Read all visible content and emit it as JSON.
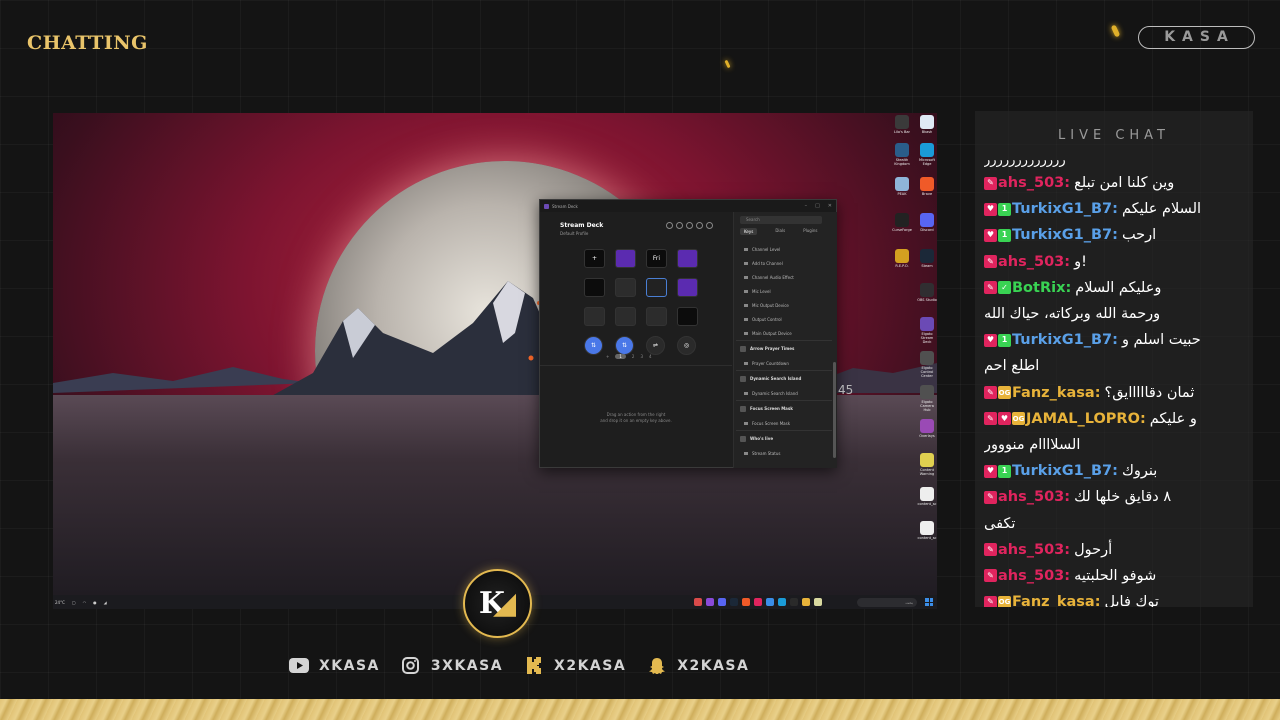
{
  "scene": {
    "title": "CHATTING",
    "brand": "KASA"
  },
  "screen": {
    "app": {
      "window_title": "Stream Deck",
      "device_name": "Stream Deck",
      "profile_name": "Default Profile",
      "keys": [
        {
          "label": "+",
          "style": "black"
        },
        {
          "label": "",
          "style": "purple"
        },
        {
          "label": "Fri",
          "style": "black"
        },
        {
          "label": "",
          "style": "purple"
        },
        {
          "label": "",
          "style": "black"
        },
        {
          "label": "",
          "style": "dark"
        },
        {
          "label": "",
          "style": "outline"
        },
        {
          "label": "",
          "style": "purple"
        },
        {
          "label": "",
          "style": "dark"
        },
        {
          "label": "",
          "style": "dark"
        },
        {
          "label": "",
          "style": "dark"
        },
        {
          "label": "",
          "style": "black"
        },
        {
          "label": "⇅",
          "style": "blue"
        },
        {
          "label": "⇅",
          "style": "blue"
        },
        {
          "label": "⇌",
          "style": "dark-round"
        },
        {
          "label": "◎",
          "style": "dark-round"
        }
      ],
      "pages": [
        "1",
        "2",
        "3",
        "4"
      ],
      "drop_hint_1": "Drag an action from the right",
      "drop_hint_2": "and drop it on an empty key above.",
      "search_placeholder": "Search",
      "tabs": [
        "Keys",
        "Dials",
        "Plugins"
      ],
      "actions": [
        {
          "kind": "item",
          "label": "Channel Level"
        },
        {
          "kind": "item",
          "label": "Add to Channel"
        },
        {
          "kind": "item",
          "label": "Channel Audio Effect"
        },
        {
          "kind": "item",
          "label": "Mic Level"
        },
        {
          "kind": "item",
          "label": "Mic Output Device"
        },
        {
          "kind": "item",
          "label": "Output Control"
        },
        {
          "kind": "item",
          "label": "Main Output Device"
        },
        {
          "kind": "group",
          "label": "Arrow Prayer Times"
        },
        {
          "kind": "item",
          "label": "Prayer Countdown"
        },
        {
          "kind": "group",
          "label": "Dynamic Search Island"
        },
        {
          "kind": "item",
          "label": "Dynamic Search Island"
        },
        {
          "kind": "group",
          "label": "Focus Screen Mask"
        },
        {
          "kind": "item",
          "label": "Focus Screen Mask"
        },
        {
          "kind": "group",
          "label": "Who's live"
        },
        {
          "kind": "item",
          "label": "Stream Status"
        }
      ]
    },
    "desktop_icons": [
      {
        "label": "Lilo's Bar",
        "color": "#3a3a3a"
      },
      {
        "label": "Bkash",
        "color": "#dfe9f5"
      },
      {
        "label": "Stealth Kingdom",
        "color": "#2a5d8a"
      },
      {
        "label": "Microsoft Edge",
        "color": "#1a9bd8"
      },
      {
        "label": "PEAK",
        "color": "#8fb5d9"
      },
      {
        "label": "Brave",
        "color": "#f05a28"
      },
      {
        "label": "CurseForge",
        "color": "#222222"
      },
      {
        "label": "Discord",
        "color": "#5865f2"
      },
      {
        "label": "R.E.P.O.",
        "color": "#d4a020"
      },
      {
        "label": "Steam",
        "color": "#1b2838"
      },
      {
        "label": "OBS Studio",
        "color": "#302e31"
      },
      {
        "label": "Elgato Stream Deck",
        "color": "#6b4ab5"
      },
      {
        "label": "Elgato Control Center",
        "color": "#505050"
      },
      {
        "label": "Elgato Camera Hub",
        "color": "#505050"
      },
      {
        "label": "Overlays",
        "color": "#9a4ab5"
      },
      {
        "label": "Content Warning",
        "color": "#e0d050"
      },
      {
        "label": "content_sc",
        "color": "#eeeeee"
      },
      {
        "label": "content_sc",
        "color": "#eeeeee"
      }
    ],
    "clock_overlay": "45",
    "taskbar": {
      "weather": "24°C",
      "search_placeholder": "بحث"
    }
  },
  "logo": {
    "letter": "K"
  },
  "socials": [
    {
      "icon": "youtube-icon",
      "handle": "XKASA"
    },
    {
      "icon": "instagram-icon",
      "handle": "3XKASA"
    },
    {
      "icon": "kick-icon",
      "handle": "X2KASA"
    },
    {
      "icon": "snapchat-icon",
      "handle": "X2KASA"
    }
  ],
  "chat": {
    "title": "LIVE CHAT",
    "top_cut": "ررررررررررررر",
    "lines": [
      {
        "badges": [
          "pencil"
        ],
        "user": "ahs_503",
        "color": "#e0245e",
        "message": "وين كلنا امن تبلع"
      },
      {
        "badges": [
          "heart",
          "one"
        ],
        "user": "TurkixG1_B7",
        "color": "#5aa0e8",
        "message": "السلام عليكم"
      },
      {
        "badges": [
          "heart",
          "one"
        ],
        "user": "TurkixG1_B7",
        "color": "#5aa0e8",
        "message": "ارحب"
      },
      {
        "badges": [
          "pencil"
        ],
        "user": "ahs_503",
        "color": "#e0245e",
        "message": "و!"
      },
      {
        "badges": [
          "pencil",
          "check"
        ],
        "user": "BotRix",
        "color": "#39d353",
        "message": "وعليكم السلام"
      },
      {
        "badges": [],
        "user": "",
        "color": "#ffffff",
        "message": "ورحمة الله وبركاته، حياك الله"
      },
      {
        "badges": [
          "heart",
          "one"
        ],
        "user": "TurkixG1_B7",
        "color": "#5aa0e8",
        "message": "حبيت اسلم و"
      },
      {
        "badges": [],
        "user": "",
        "color": "#ffffff",
        "message": "اطلع احم"
      },
      {
        "badges": [
          "pencil",
          "og"
        ],
        "user": "Fanz_kasa",
        "color": "#e8b33a",
        "message": "ثمان دقااااايق؟"
      },
      {
        "badges": [
          "pencil",
          "heart",
          "og"
        ],
        "user": "JAMAL_LOPRO",
        "color": "#e8b33a",
        "message": "و عليكم"
      },
      {
        "badges": [],
        "user": "",
        "color": "#ffffff",
        "message": "السلاااام منووور"
      },
      {
        "badges": [
          "heart",
          "one"
        ],
        "user": "TurkixG1_B7",
        "color": "#5aa0e8",
        "message": "بنروك"
      },
      {
        "badges": [
          "pencil"
        ],
        "user": "ahs_503",
        "color": "#e0245e",
        "message": "٨ دقايق خلها لك"
      },
      {
        "badges": [],
        "user": "",
        "color": "#ffffff",
        "message": "تكفى"
      },
      {
        "badges": [
          "pencil"
        ],
        "user": "ahs_503",
        "color": "#e0245e",
        "message": "أرحول"
      },
      {
        "badges": [
          "pencil"
        ],
        "user": "ahs_503",
        "color": "#e0245e",
        "message": "شوفو الحلبتيه"
      },
      {
        "badges": [
          "pencil",
          "og"
        ],
        "user": "Fanz_kasa",
        "color": "#e8b33a",
        "message": "توك فايل"
      }
    ]
  }
}
